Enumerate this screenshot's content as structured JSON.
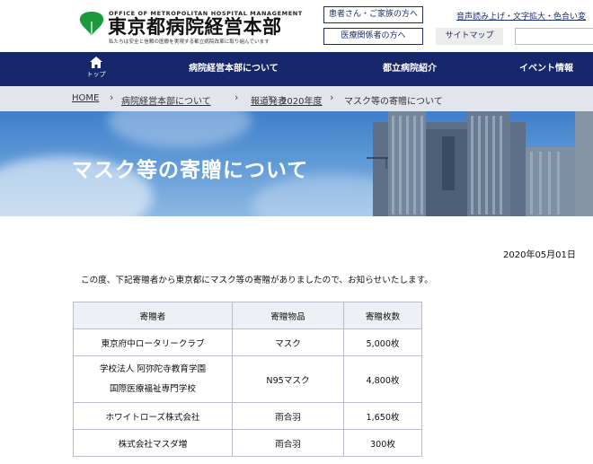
{
  "header": {
    "logo_en": "OFFICE OF METROPOLITAN HOSPITAL MANAGEMENT",
    "logo_jp": "東京都病院経営本部",
    "logo_sub": "私たちは安全と信頼の医療を実現する都立病院改革に取り組んでいます",
    "patient_button": "患者さん・ご家族の方へ",
    "medical_button": "医療関係者の方へ",
    "sitemap": "サイトマップ",
    "accessibility": "音声読み上げ・文字拡大・色合い変",
    "search_placeholder": ""
  },
  "nav": {
    "home_label": "トップ",
    "items": [
      "病院経営本部について",
      "都立病院紹介",
      "イベント情報"
    ]
  },
  "breadcrumb": [
    "HOME",
    "病院経営本部について",
    "報道発表",
    "2020年度",
    "マスク等の寄贈について"
  ],
  "hero": {
    "title": "マスク等の寄贈について"
  },
  "article": {
    "date": "2020年05月01日",
    "intro": "この度、下記寄贈者から東京都にマスク等の寄贈がありましたので、お知らせいたします。",
    "table": {
      "headers": [
        "寄贈者",
        "寄贈物品",
        "寄贈枚数"
      ],
      "rows": [
        {
          "donor": [
            "東京府中ロータリークラブ"
          ],
          "item": "マスク",
          "count": "5,000枚"
        },
        {
          "donor": [
            "学校法人 阿弥陀寺教育学園",
            "国際医療福祉専門学校"
          ],
          "item": "N95マスク",
          "count": "4,800枚"
        },
        {
          "donor": [
            "ホワイトローズ株式会社"
          ],
          "item": "雨合羽",
          "count": "1,650枚"
        },
        {
          "donor": [
            "株式会社マスダ増"
          ],
          "item": "雨合羽",
          "count": "300枚"
        }
      ]
    }
  },
  "colors": {
    "navy": "#16286b",
    "breadcrumb_bg": "#e2e5ec",
    "logo_green": "#1a9a3c"
  },
  "icons": {
    "logo": "ginkgo-leaf-icon",
    "home": "home-icon",
    "breadcrumb_separator": "chevron-right-icon"
  }
}
